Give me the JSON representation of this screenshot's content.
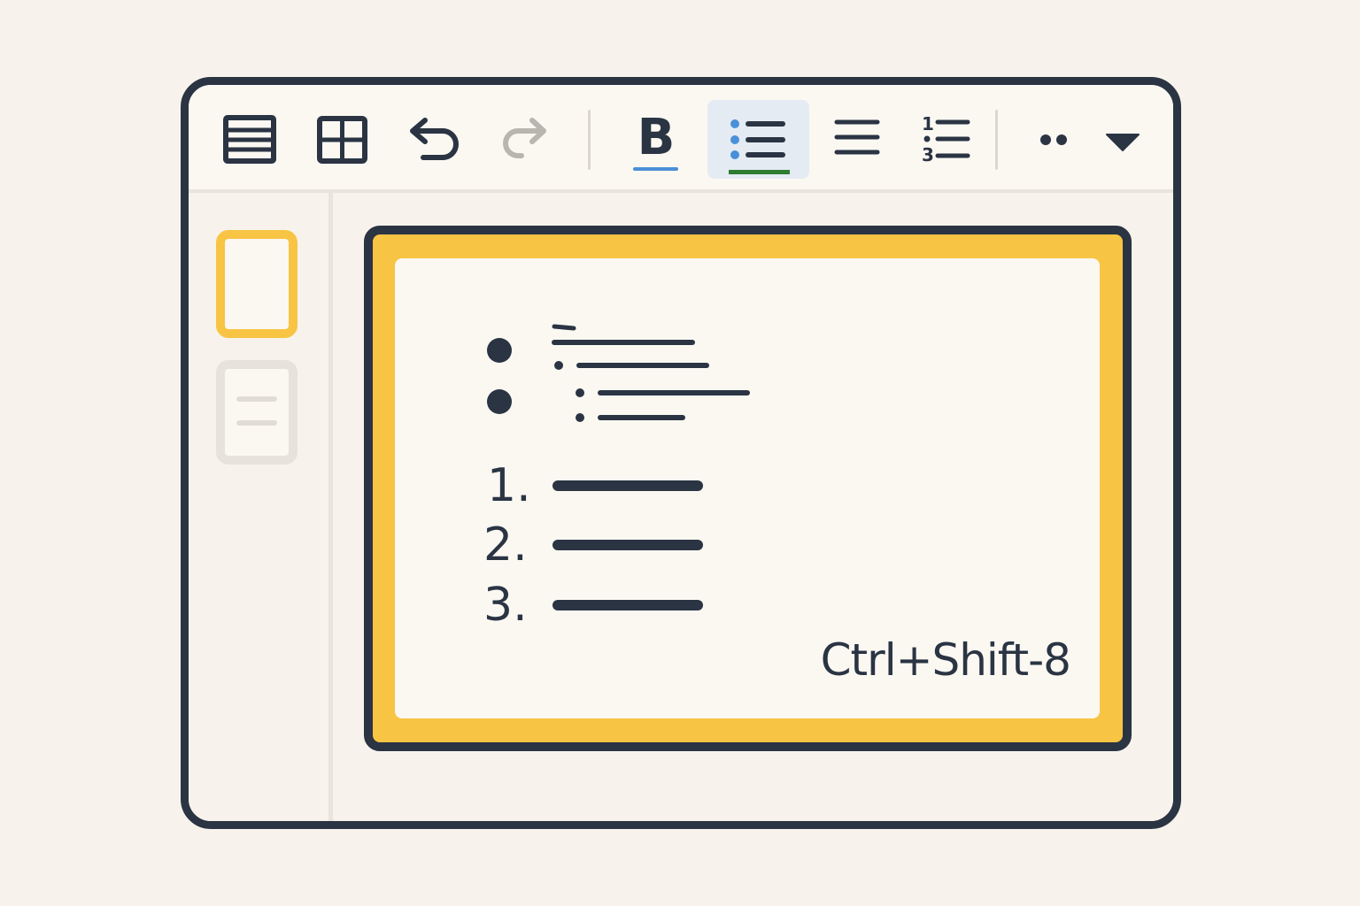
{
  "toolbar": {
    "buttons": [
      {
        "icon": "layout-icon"
      },
      {
        "icon": "table-icon"
      },
      {
        "icon": "undo-icon"
      },
      {
        "icon": "redo-icon"
      },
      {
        "icon": "bold-icon",
        "label": "B"
      },
      {
        "icon": "bulleted-list-icon",
        "active": true
      },
      {
        "icon": "align-icon"
      },
      {
        "icon": "numbered-list-icon"
      },
      {
        "icon": "more-icon"
      },
      {
        "icon": "dropdown-icon"
      }
    ],
    "bold_label": "B",
    "numbered_icon_digits": [
      "1",
      "3"
    ]
  },
  "sidebar": {
    "slides": [
      {
        "name": "slide-thumbnail-1",
        "selected": true
      },
      {
        "name": "slide-thumbnail-2",
        "selected": false
      }
    ]
  },
  "slide": {
    "numbered_items": [
      "1.",
      "2.",
      "3."
    ],
    "shortcut_hint": "Ctrl+Shift-8"
  },
  "colors": {
    "frame": "#2a3443",
    "accent_yellow": "#f8c444",
    "bold_underline": "#4a90d9",
    "list_underline": "#2e7d32",
    "active_bg": "#e4ebf3",
    "background": "#f7f3ec"
  }
}
